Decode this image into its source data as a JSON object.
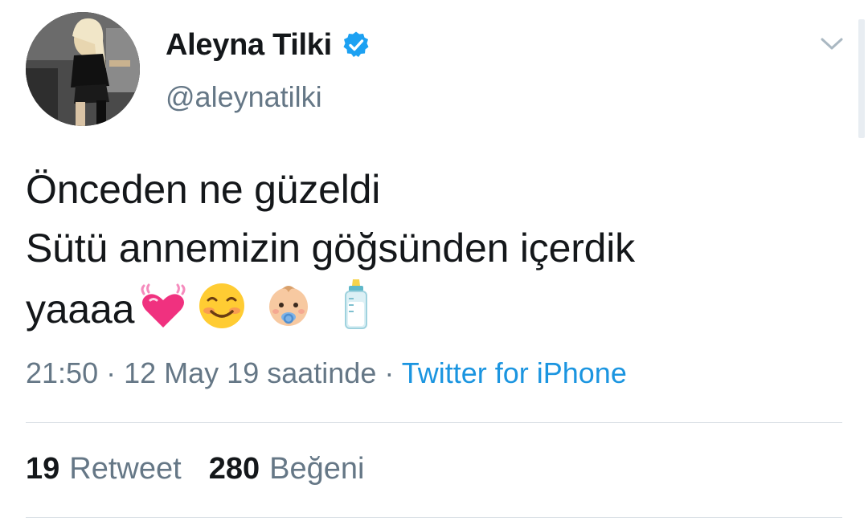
{
  "user": {
    "display_name": "Aleyna Tilki",
    "handle": "@aleynatilki",
    "verified_icon": "verified-badge-icon"
  },
  "tweet": {
    "lines": [
      "Önceden ne güzeldi",
      "Sütü annemizin göğsünden içerdik",
      "yaaaa"
    ],
    "emojis": [
      "beating-heart",
      "smiling-face",
      "baby-with-pacifier",
      "baby-bottle"
    ]
  },
  "meta": {
    "time": "21:50",
    "separator": "·",
    "date": "12 May 19 saatinde",
    "source": "Twitter for iPhone"
  },
  "stats": {
    "retweet_count": "19",
    "retweet_label": "Retweet",
    "like_count": "280",
    "like_label": "Beğeni"
  },
  "colors": {
    "accent": "#1b95e0",
    "secondary_text": "#657786",
    "primary_text": "#14171a",
    "divider": "#d6dde3"
  }
}
